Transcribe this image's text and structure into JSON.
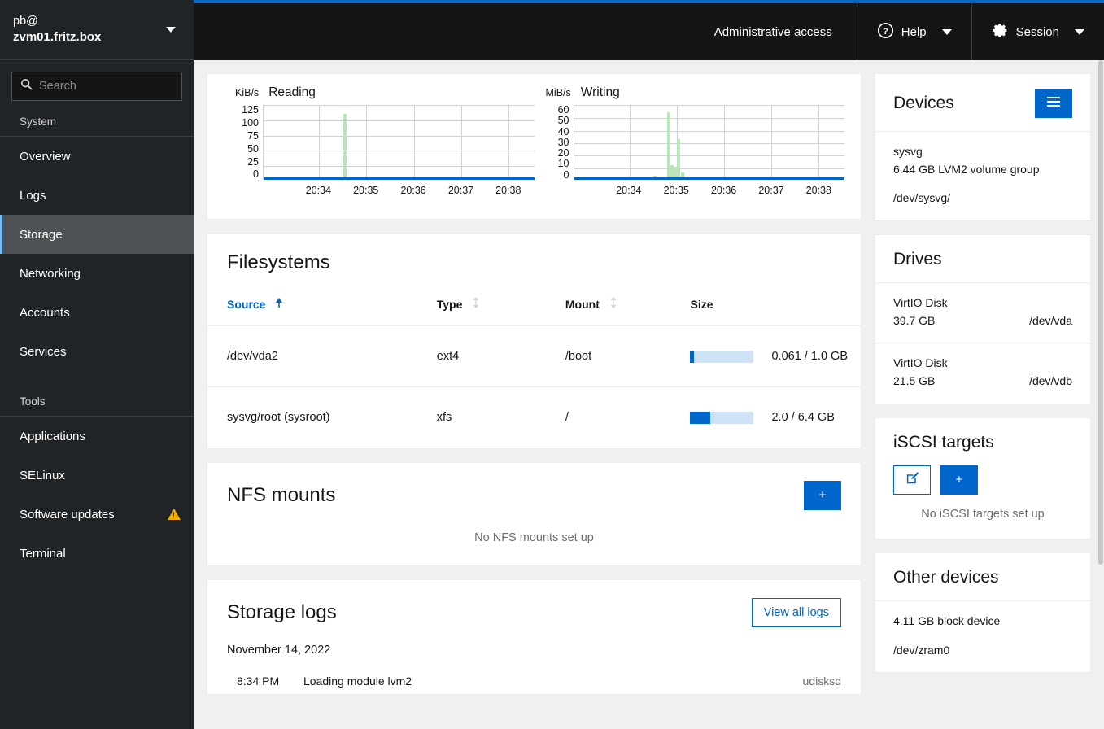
{
  "sidebar": {
    "host": {
      "user": "pb@",
      "name": "zvm01.fritz.box",
      "caret_icon": "caret-down-icon"
    },
    "search": {
      "placeholder": "Search",
      "value": "",
      "icon": "search-icon"
    },
    "groups": [
      {
        "title": "System",
        "items": [
          {
            "label": "Overview",
            "active": false
          },
          {
            "label": "Logs",
            "active": false
          },
          {
            "label": "Storage",
            "active": true
          },
          {
            "label": "Networking",
            "active": false
          },
          {
            "label": "Accounts",
            "active": false
          },
          {
            "label": "Services",
            "active": false
          }
        ]
      },
      {
        "title": "Tools",
        "items": [
          {
            "label": "Applications",
            "active": false
          },
          {
            "label": "SELinux",
            "active": false
          },
          {
            "label": "Software updates",
            "active": false,
            "badge": "warning-triangle-icon"
          },
          {
            "label": "Terminal",
            "active": false
          }
        ]
      }
    ]
  },
  "topbar": {
    "admin_access": "Administrative access",
    "help": {
      "label": "Help",
      "icon": "help-circle-icon"
    },
    "session": {
      "label": "Session",
      "icon": "gear-icon"
    }
  },
  "chart_data": [
    {
      "type": "bar",
      "title": "Reading",
      "unit": "KiB/s",
      "ylabel": "KiB/s",
      "xlabel": "",
      "yticks": [
        125,
        100,
        75,
        50,
        25,
        0
      ],
      "ylim": [
        0,
        125
      ],
      "xticks": [
        "20:34",
        "20:35",
        "20:36",
        "20:37",
        "20:38"
      ],
      "grid": true,
      "series": [
        {
          "name": "read",
          "color": "#bae5b9",
          "points": [
            {
              "x": "20:34.7",
              "y": 108
            }
          ]
        }
      ]
    },
    {
      "type": "bar",
      "title": "Writing",
      "unit": "MiB/s",
      "ylabel": "MiB/s",
      "xlabel": "",
      "yticks": [
        60,
        50,
        40,
        30,
        20,
        10,
        0
      ],
      "ylim": [
        0,
        60
      ],
      "xticks": [
        "20:34",
        "20:35",
        "20:36",
        "20:37",
        "20:38"
      ],
      "grid": true,
      "series": [
        {
          "name": "write",
          "color": "#bae5b9",
          "points": [
            {
              "x": "20:34.65",
              "y": 1.5
            },
            {
              "x": "20:34.95",
              "y": 53
            },
            {
              "x": "20:35.02",
              "y": 10
            },
            {
              "x": "20:35.08",
              "y": 9
            },
            {
              "x": "20:35.14",
              "y": 31
            },
            {
              "x": "20:35.22",
              "y": 4
            }
          ]
        }
      ]
    }
  ],
  "filesystems": {
    "title": "Filesystems",
    "columns": [
      {
        "label": "Source",
        "sort": "asc",
        "sort_icon": "sort-asc-icon"
      },
      {
        "label": "Type",
        "sort": "none",
        "sort_icon": "sort-icon"
      },
      {
        "label": "Mount",
        "sort": "none",
        "sort_icon": "sort-icon"
      },
      {
        "label": "Size",
        "sort": null,
        "sort_icon": null
      }
    ],
    "rows": [
      {
        "source": "/dev/vda2",
        "type": "ext4",
        "mount": "/boot",
        "used_pct": 6,
        "size_text": "0.061 / 1.0 GB"
      },
      {
        "source": "sysvg/root (sysroot)",
        "type": "xfs",
        "mount": "/",
        "used_pct": 31,
        "size_text": "2.0 / 6.4 GB"
      }
    ]
  },
  "nfs": {
    "title": "NFS mounts",
    "add_label": "+",
    "empty_text": "No NFS mounts set up"
  },
  "logs": {
    "title": "Storage logs",
    "view_all_label": "View all logs",
    "date": "November 14, 2022",
    "entries": [
      {
        "time": "8:34 PM",
        "message": "Loading module lvm2",
        "source": "udisksd"
      }
    ]
  },
  "devices": {
    "title": "Devices",
    "menu_icon": "hamburger-icon",
    "items": [
      {
        "name": "sysvg",
        "description": "6.44 GB LVM2 volume group",
        "path": "/dev/sysvg/"
      }
    ]
  },
  "drives": {
    "title": "Drives",
    "items": [
      {
        "name": "VirtIO Disk",
        "size": "39.7 GB",
        "path": "/dev/vda"
      },
      {
        "name": "VirtIO Disk",
        "size": "21.5 GB",
        "path": "/dev/vdb"
      }
    ]
  },
  "iscsi": {
    "title": "iSCSI targets",
    "edit_icon": "edit-pencil-icon",
    "add_label": "+",
    "empty_text": "No iSCSI targets set up"
  },
  "other_devices": {
    "title": "Other devices",
    "items": [
      {
        "description": "4.11 GB block device",
        "path": "/dev/zram0"
      }
    ]
  },
  "colors": {
    "accent_blue": "#0866c6",
    "primary_blue": "#06c",
    "sidebar_bg": "#212427",
    "topbar_bg": "#151515",
    "warning": "#f0ab00",
    "chart_green": "#bae5b9"
  }
}
